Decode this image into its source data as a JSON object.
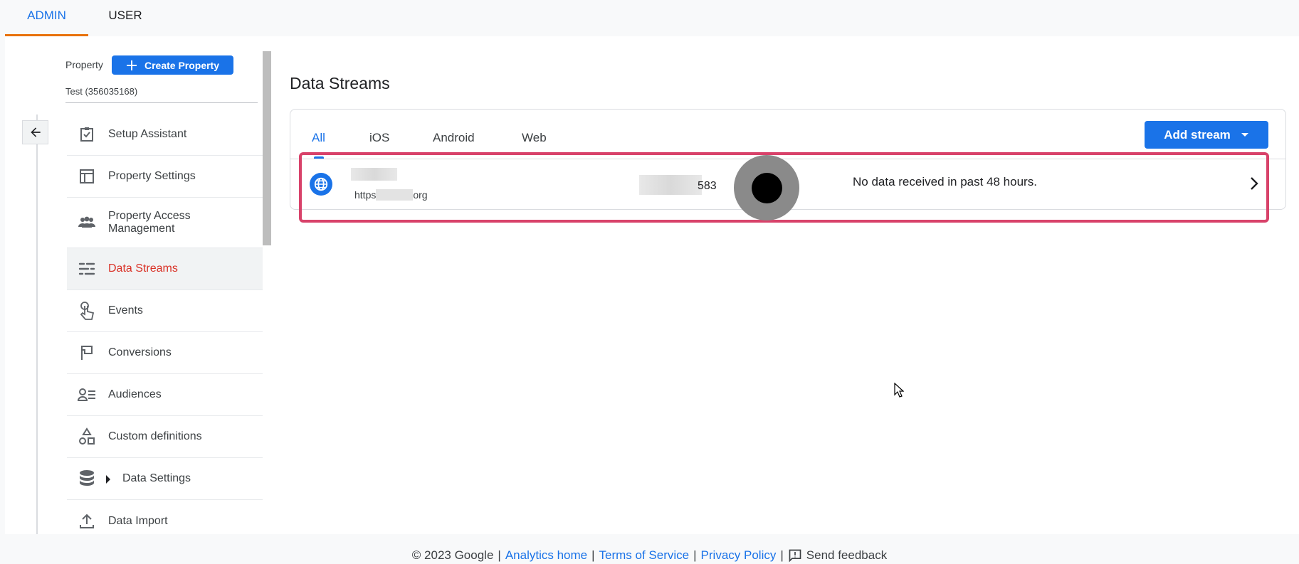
{
  "top_tabs": [
    {
      "label": "ADMIN"
    },
    {
      "label": "USER"
    }
  ],
  "property": {
    "label": "Property",
    "create_label": "Create Property",
    "name": "Test (356035168)"
  },
  "sidebar": {
    "items": [
      {
        "label": "Setup Assistant"
      },
      {
        "label": "Property Settings"
      },
      {
        "label": "Property Access Management"
      },
      {
        "label": "Data Streams"
      },
      {
        "label": "Events"
      },
      {
        "label": "Conversions"
      },
      {
        "label": "Audiences"
      },
      {
        "label": "Custom definitions"
      },
      {
        "label": "Data Settings"
      },
      {
        "label": "Data Import"
      }
    ],
    "active_index": 3
  },
  "main": {
    "title": "Data Streams",
    "tabs": [
      {
        "label": "All"
      },
      {
        "label": "iOS"
      },
      {
        "label": "Android"
      },
      {
        "label": "Web"
      }
    ],
    "add_stream_label": "Add stream",
    "stream": {
      "url_prefix": "https",
      "url_suffix": "org",
      "id_suffix": "583",
      "status": "No data received in past 48 hours."
    }
  },
  "footer": {
    "copyright": "© 2023 Google",
    "sep": "|",
    "analytics_home": "Analytics home",
    "terms": "Terms of Service",
    "privacy": "Privacy Policy",
    "feedback": "Send feedback"
  },
  "colors": {
    "accent": "#1a73e8",
    "active_nav": "#d93025",
    "highlight": "#d8426a",
    "tab_underline": "#e8710a"
  }
}
